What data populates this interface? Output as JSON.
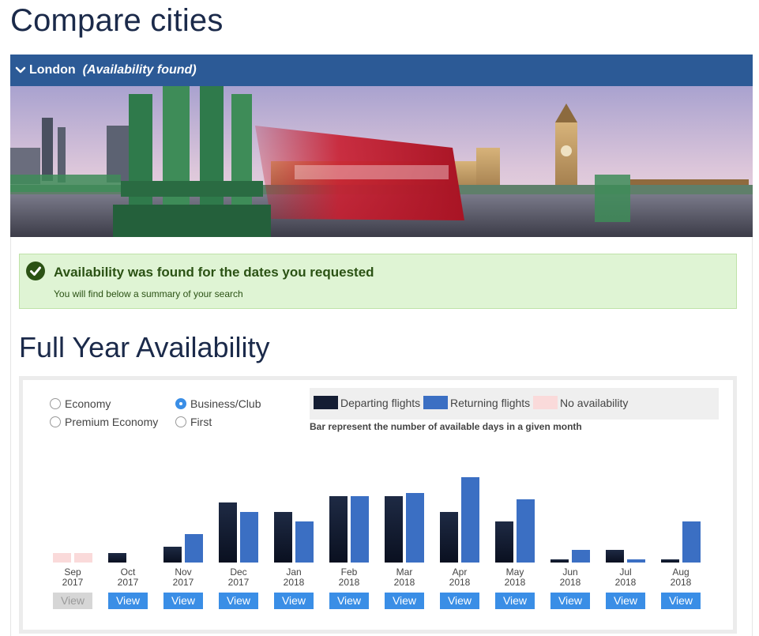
{
  "page": {
    "title": "Compare cities"
  },
  "city": {
    "name": "London",
    "status": "(Availability found)"
  },
  "alert": {
    "title": "Availability was found for the dates you requested",
    "subtitle": "You will find below a summary of your search"
  },
  "section": {
    "title": "Full Year Availability"
  },
  "cabins": {
    "options": [
      "Economy",
      "Premium Economy",
      "Business/Club",
      "First"
    ],
    "selected": "Business/Club"
  },
  "legend": {
    "departing": "Departing flights",
    "returning": "Returning flights",
    "none": "No availability",
    "note": "Bar represent the number of available days in a given month"
  },
  "colors": {
    "departing_top": "#1e2a44",
    "departing_bottom": "#0a1020",
    "returning": "#3b6fc3",
    "no_availability": "#fadada",
    "header": "#2c5a96",
    "button": "#3a8ee6"
  },
  "view_label": "View",
  "chart_data": {
    "type": "bar",
    "categories": [
      "Sep 2017",
      "Oct 2017",
      "Nov 2017",
      "Dec 2017",
      "Jan 2018",
      "Feb 2018",
      "Mar 2018",
      "Apr 2018",
      "May 2018",
      "Jun 2018",
      "Jul 2018",
      "Aug 2018"
    ],
    "month_names": [
      "Sep",
      "Oct",
      "Nov",
      "Dec",
      "Jan",
      "Feb",
      "Mar",
      "Apr",
      "May",
      "Jun",
      "Jul",
      "Aug"
    ],
    "years": [
      "2017",
      "2017",
      "2017",
      "2017",
      "2018",
      "2018",
      "2018",
      "2018",
      "2018",
      "2018",
      "2018",
      "2018"
    ],
    "series": [
      {
        "name": "Departing flights",
        "values": [
          0,
          3,
          5,
          19,
          16,
          21,
          21,
          16,
          13,
          1,
          4,
          1
        ]
      },
      {
        "name": "Returning flights",
        "values": [
          0,
          0,
          9,
          16,
          13,
          21,
          22,
          27,
          20,
          4,
          1,
          13
        ]
      }
    ],
    "no_availability": [
      true,
      false,
      false,
      false,
      false,
      false,
      false,
      false,
      false,
      false,
      false,
      false
    ],
    "view_enabled": [
      false,
      true,
      true,
      true,
      true,
      true,
      true,
      true,
      true,
      true,
      true,
      true
    ],
    "ylim": [
      0,
      31
    ],
    "grid": false,
    "legend_position": "top-right"
  }
}
